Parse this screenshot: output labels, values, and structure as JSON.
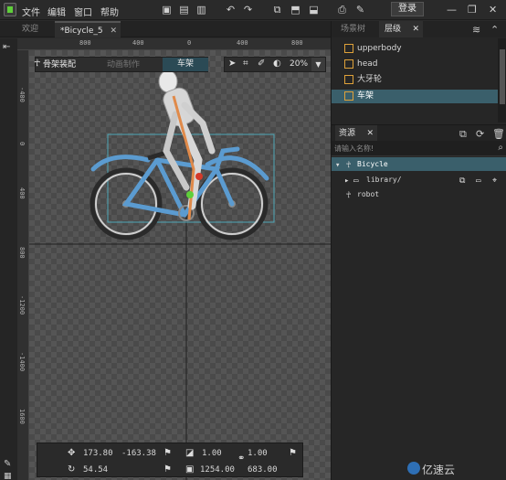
{
  "menubar": {
    "items": [
      "文件",
      "编辑",
      "窗口",
      "帮助"
    ],
    "login_label": "登录",
    "minimize": "—",
    "restore": "❐",
    "close": "✕"
  },
  "doc_tabs": {
    "welcome": "欢迎",
    "active": "*Bicycle_5",
    "close": "✕"
  },
  "rulers": {
    "top": [
      "800",
      "400",
      "0",
      "400",
      "800"
    ],
    "left": [
      "-400",
      "0",
      "400",
      "800",
      "-1200",
      "-1400",
      "1600"
    ]
  },
  "mode_bar": {
    "bone": "骨架装配",
    "anim": "动画制作",
    "frame": "车架"
  },
  "view_tools": {
    "zoom": "20%"
  },
  "transform": {
    "x": "173.80",
    "y": "-163.38",
    "rotation": "54.54",
    "scale_x": "1.00",
    "scale_y": "1.00",
    "width": "1254.00",
    "height": "683.00"
  },
  "right_tabs": {
    "scene_tree": "场景树",
    "hierarchy": "层级",
    "close": "✕"
  },
  "hierarchy": {
    "items": [
      "upperbody",
      "head",
      "大牙轮",
      "车架"
    ]
  },
  "resources": {
    "tab": "资源",
    "search_placeholder": "请输入名称!",
    "items": [
      "Bicycle",
      "library/",
      "robot"
    ]
  },
  "watermark": "亿速云",
  "colors": {
    "selection": "#3a5f6b",
    "frame_mode_bg": "#2b4a55",
    "accent_green": "#5fcf3a",
    "bike_blue": "#5b9bd0"
  }
}
